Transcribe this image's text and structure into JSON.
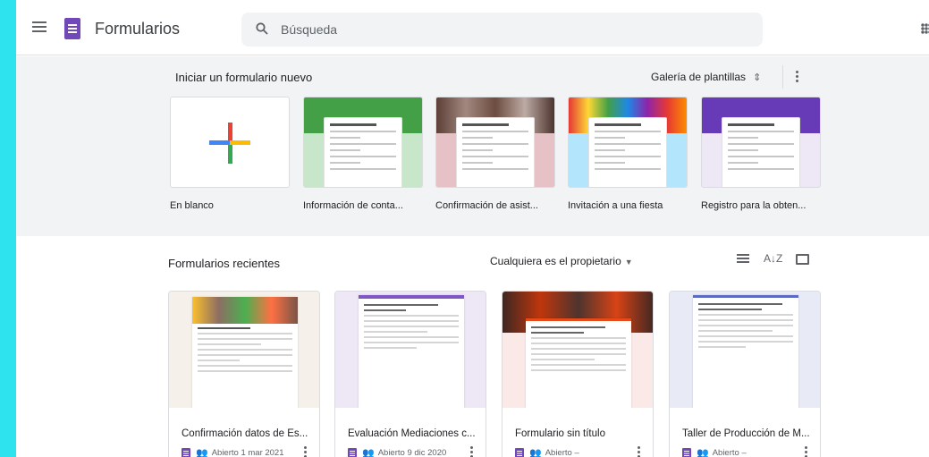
{
  "header": {
    "app_title": "Formularios",
    "search_placeholder": "Búsqueda"
  },
  "templates": {
    "section_title": "Iniciar un formulario nuevo",
    "gallery_label": "Galería de plantillas",
    "items": [
      {
        "label": "En blanco",
        "color": "#ffffff"
      },
      {
        "label": "Información de conta...",
        "color": "#4caf50"
      },
      {
        "label": "Confirmación de asist...",
        "color": "#d7a1a8"
      },
      {
        "label": "Invitación a una fiesta",
        "color": "#4fc3f7"
      },
      {
        "label": "Registro para la obten...",
        "color": "#673ab7"
      }
    ]
  },
  "recent": {
    "section_title": "Formularios recientes",
    "owner_filter": "Cualquiera es el propietario",
    "forms": [
      {
        "title": "Confirmación datos de Es...",
        "opened": "Abierto 1 mar 2021",
        "accent": "#795548"
      },
      {
        "title": "Evaluación Mediaciones c...",
        "opened": "Abierto 9 dic 2020",
        "accent": "#9575cd"
      },
      {
        "title": "Formulario sin título",
        "opened": "Abierto –",
        "accent": "#e64a19"
      },
      {
        "title": "Taller de Producción de M...",
        "opened": "Abierto –",
        "accent": "#5c6bc0"
      }
    ]
  }
}
